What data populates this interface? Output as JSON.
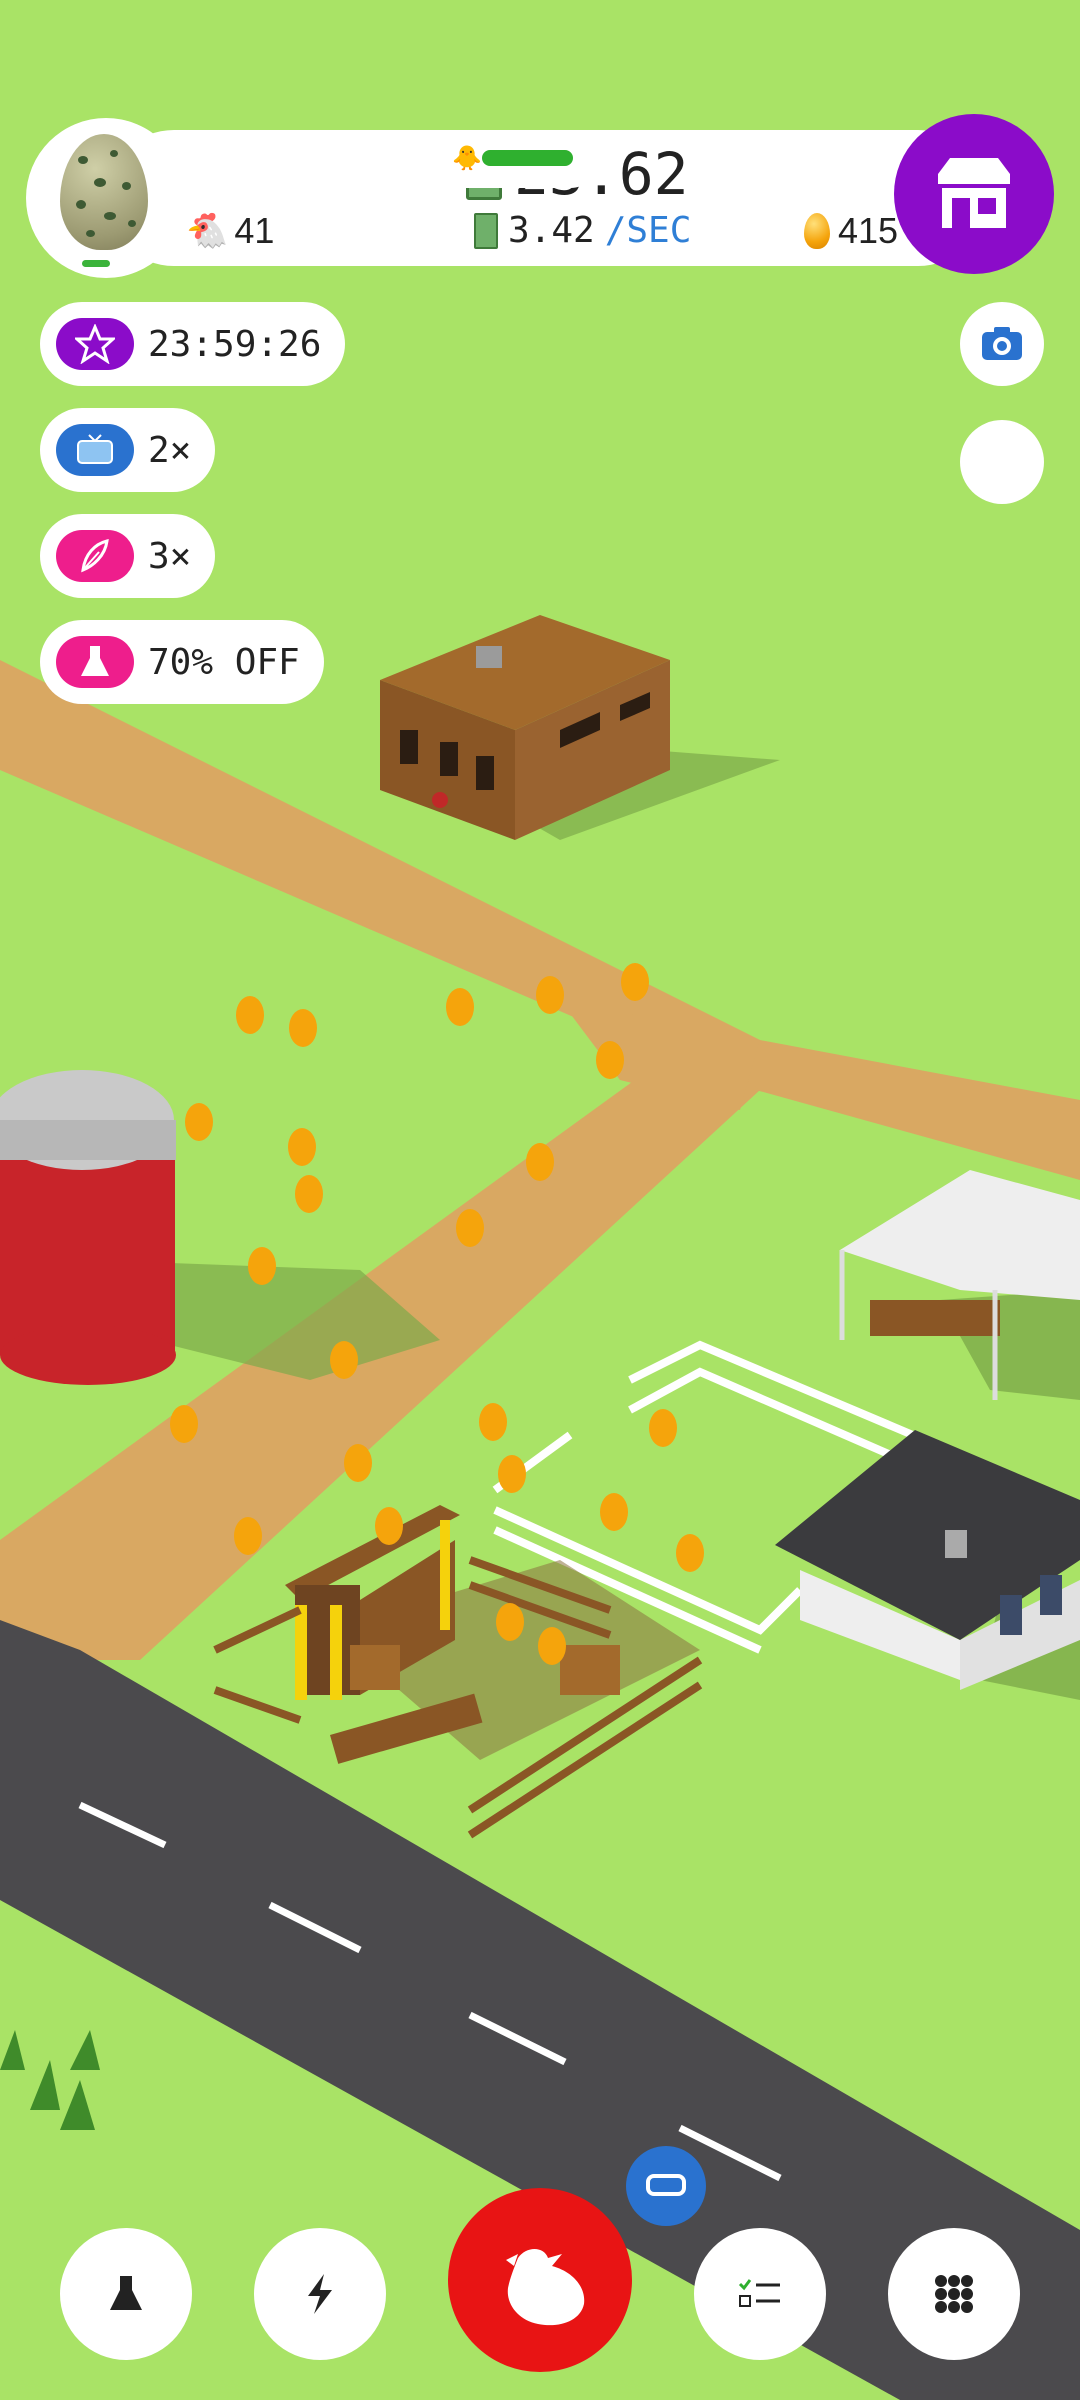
{
  "hud": {
    "money": "23.62",
    "rate_value": "3.42",
    "rate_unit": "/SEC",
    "chicken_count": "41",
    "egg_count": "415",
    "progress_fraction": 0.95,
    "shop_icon": "shop-icon"
  },
  "boosts": [
    {
      "icon": "star-icon",
      "label": "23:59:26",
      "color": "#8b0cc9"
    },
    {
      "icon": "tv-icon",
      "label": "2×",
      "color": "#2a72cf"
    },
    {
      "icon": "feather-icon",
      "label": "3×",
      "color": "#ee1e8c"
    },
    {
      "icon": "flask-icon",
      "label": "70% OFF",
      "color": "#ee1e8c"
    }
  ],
  "side_buttons": {
    "camera_icon": "camera-icon"
  },
  "bottom_nav": [
    {
      "icon": "flask-icon"
    },
    {
      "icon": "lightning-icon"
    },
    {
      "icon": "chicken-icon"
    },
    {
      "icon": "checklist-icon"
    },
    {
      "icon": "grid-icon"
    }
  ],
  "colors": {
    "grass": "#a9e366",
    "road": "#4b4a4d",
    "path": "#d9a862",
    "shop": "#8b0cc9",
    "main_button": "#e81414"
  }
}
